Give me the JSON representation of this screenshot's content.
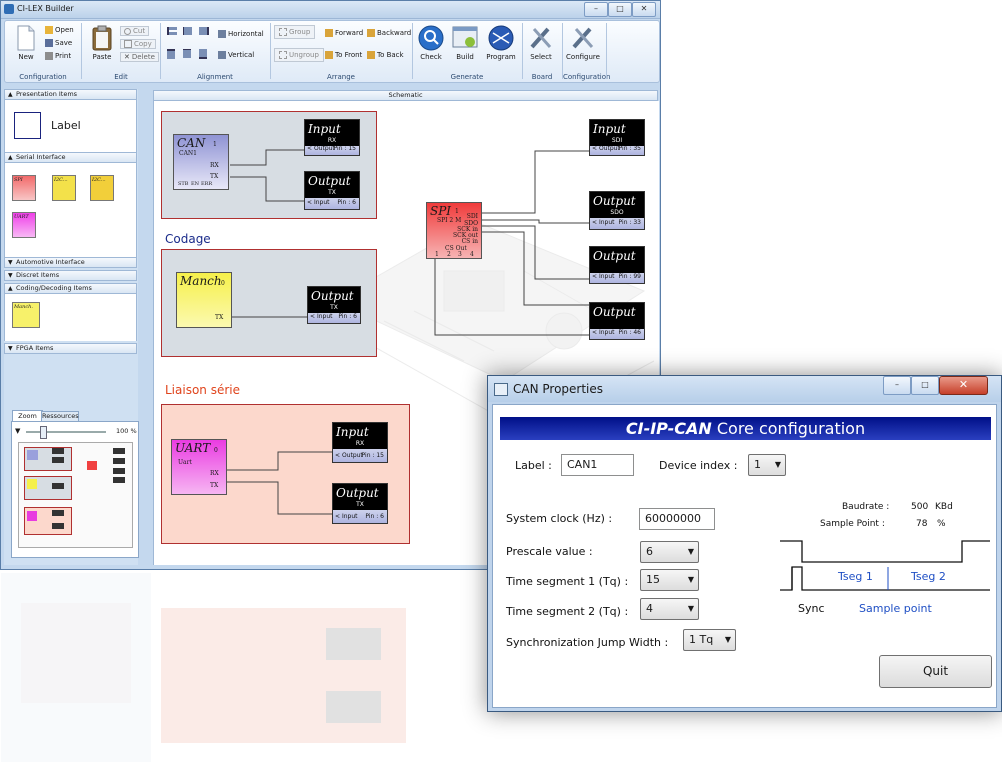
{
  "app": {
    "title": "CI-LEX Builder"
  },
  "ribbon": {
    "configuration": {
      "new": "New",
      "open": "Open",
      "save": "Save",
      "print": "Print",
      "label": "Configuration"
    },
    "edit": {
      "paste": "Paste",
      "cut": "Cut",
      "copy": "Copy",
      "delete": "Delete",
      "label": "Edit"
    },
    "alignment": {
      "horizontal": "Horizontal",
      "vertical": "Vertical",
      "label": "Alignment"
    },
    "arrange": {
      "group": "Group",
      "ungroup": "Ungroup",
      "forward": "Forward",
      "backward": "Backward",
      "to_front": "To Front",
      "to_back": "To Back",
      "label": "Arrange"
    },
    "generate": {
      "check": "Check",
      "build": "Build",
      "program": "Program",
      "label": "Generate"
    },
    "board": {
      "select": "Select",
      "label": "Board"
    },
    "configuration2": {
      "configure": "Configure",
      "label": "Configuration"
    }
  },
  "left_panel": {
    "presentation_items": "Presentation Items",
    "label_item": "Label",
    "serial_interface": "Serial Interface",
    "serial_items": [
      "SPI",
      "I2C...",
      "I2C...",
      "UART"
    ],
    "automotive_interface": "Automotive Interface",
    "discret_items": "Discret Items",
    "coding_decoding_items": "Coding/Decoding Items",
    "coding_item": "Manch.",
    "fpga_items": "FPGA Items",
    "tabs": [
      "Zoom",
      "Ressources"
    ],
    "zoom_value": "100 %",
    "zoom_fraction": 0.17
  },
  "schematic": {
    "header": "Schematic",
    "can_block": {
      "name": "CAN",
      "index": "1",
      "instance": "CAN1",
      "rx": "RX",
      "tx": "TX",
      "stb": "STB",
      "en": "EN",
      "err": "ERR"
    },
    "codage_title": "Codage",
    "manch_block": {
      "name": "Manch",
      "index": "0",
      "tx": "TX"
    },
    "liaison_title": "Liaison série",
    "uart_block": {
      "name": "UART",
      "index": "0",
      "instance": "Uart",
      "rx": "RX",
      "tx": "TX"
    },
    "spi_block": {
      "name": "SPI",
      "index": "1",
      "instance": "SPI 2 M",
      "sdi": "SDI",
      "sdo": "SDO",
      "sck_in": "SCK in",
      "sck_out": "SCK out",
      "cs_in": "CS in",
      "cs_out": "CS Out",
      "cs_nums": [
        "1",
        "2",
        "3",
        "4"
      ]
    },
    "io_blocks": [
      {
        "kind": "Input",
        "signal": "RX",
        "port": "Output",
        "pin_label": "Pin :",
        "pin": "15"
      },
      {
        "kind": "Output",
        "signal": "TX",
        "port": "Input",
        "pin_label": "Pin :",
        "pin": "6"
      },
      {
        "kind": "Output",
        "signal": "TX",
        "port": "Input",
        "pin_label": "Pin :",
        "pin": "6"
      },
      {
        "kind": "Input",
        "signal": "RX",
        "port": "Output",
        "pin_label": "Pin :",
        "pin": "15"
      },
      {
        "kind": "Output",
        "signal": "TX",
        "port": "Input",
        "pin_label": "Pin :",
        "pin": "6"
      },
      {
        "kind": "Input",
        "signal": "SDI",
        "port": "Output",
        "pin_label": "Pin :",
        "pin": "35"
      },
      {
        "kind": "Output",
        "signal": "SDO",
        "port": "Input",
        "pin_label": "Pin :",
        "pin": "33"
      },
      {
        "kind": "Output",
        "signal": "",
        "port": "Input",
        "pin_label": "Pin :",
        "pin": "99"
      },
      {
        "kind": "Output",
        "signal": "",
        "port": "Input",
        "pin_label": "Pin :",
        "pin": "46"
      }
    ]
  },
  "dialog": {
    "title": "CAN Properties",
    "banner_bold": "CI-IP-CAN",
    "banner_rest": " Core configuration",
    "label_label": "Label :",
    "label_value": "CAN1",
    "device_index_label": "Device index :",
    "device_index_value": "1",
    "system_clock_label": "System clock (Hz) :",
    "system_clock_value": "60000000",
    "prescale_label": "Prescale value :",
    "prescale_value": "6",
    "tseg1_label": "Time segment 1 (Tq) :",
    "tseg1_value": "15",
    "tseg2_label": "Time segment 2 (Tq) :",
    "tseg2_value": "4",
    "sjw_label": "Synchronization Jump Width :",
    "sjw_value": "1 Tq",
    "baudrate_label": "Baudrate :",
    "baudrate_value": "500",
    "baudrate_unit": "KBd",
    "sample_point_label": "Sample Point :",
    "sample_point_value": "78",
    "sample_point_unit": "%",
    "tseg1_text": "Tseg 1",
    "tseg2_text": "Tseg 2",
    "sync_text": "Sync",
    "sample_point_text": "Sample point",
    "quit": "Quit"
  },
  "colors": {
    "accent_blue": "#1f4fc4",
    "banner": "#0c1f99",
    "frame_red": "#b03030",
    "liaison_bg": "#fcd8cc",
    "frame_bg": "#d7dde3"
  }
}
